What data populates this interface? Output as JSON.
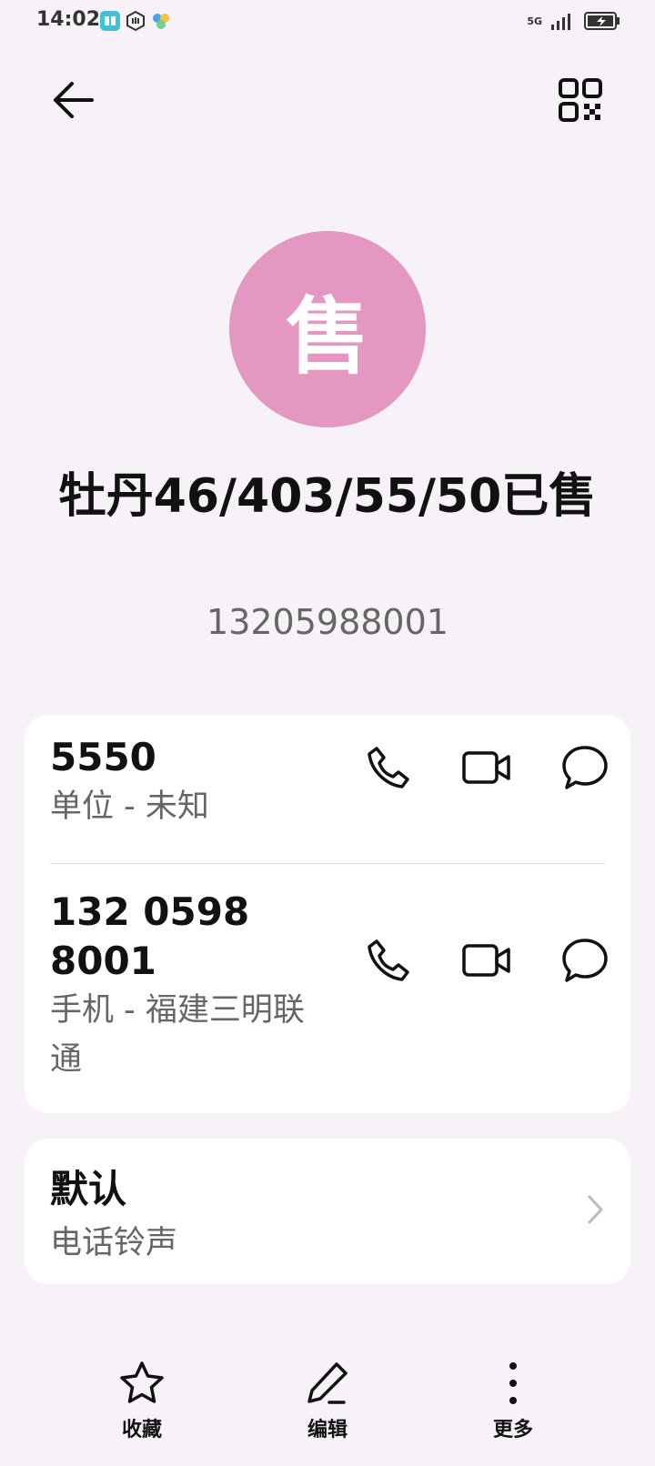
{
  "status_bar": {
    "time": "14:02",
    "network": "5G"
  },
  "header": {
    "back_icon": "arrow-left-icon",
    "qr_icon": "qr-code-icon"
  },
  "contact": {
    "avatar_letter": "售",
    "avatar_color": "#e497c0",
    "name": "牡丹46/403/55/50已售",
    "number": "13205988001"
  },
  "phones": [
    {
      "number": "5550",
      "label": "单位 - 未知"
    },
    {
      "number": "132 0598 8001",
      "label": "手机 - 福建三明联通"
    }
  ],
  "ringtone": {
    "title": "默认",
    "subtitle": "电话铃声"
  },
  "bottom_nav": [
    {
      "label": "收藏",
      "icon": "star-icon"
    },
    {
      "label": "编辑",
      "icon": "pen-icon"
    },
    {
      "label": "更多",
      "icon": "more-vertical-icon"
    }
  ]
}
